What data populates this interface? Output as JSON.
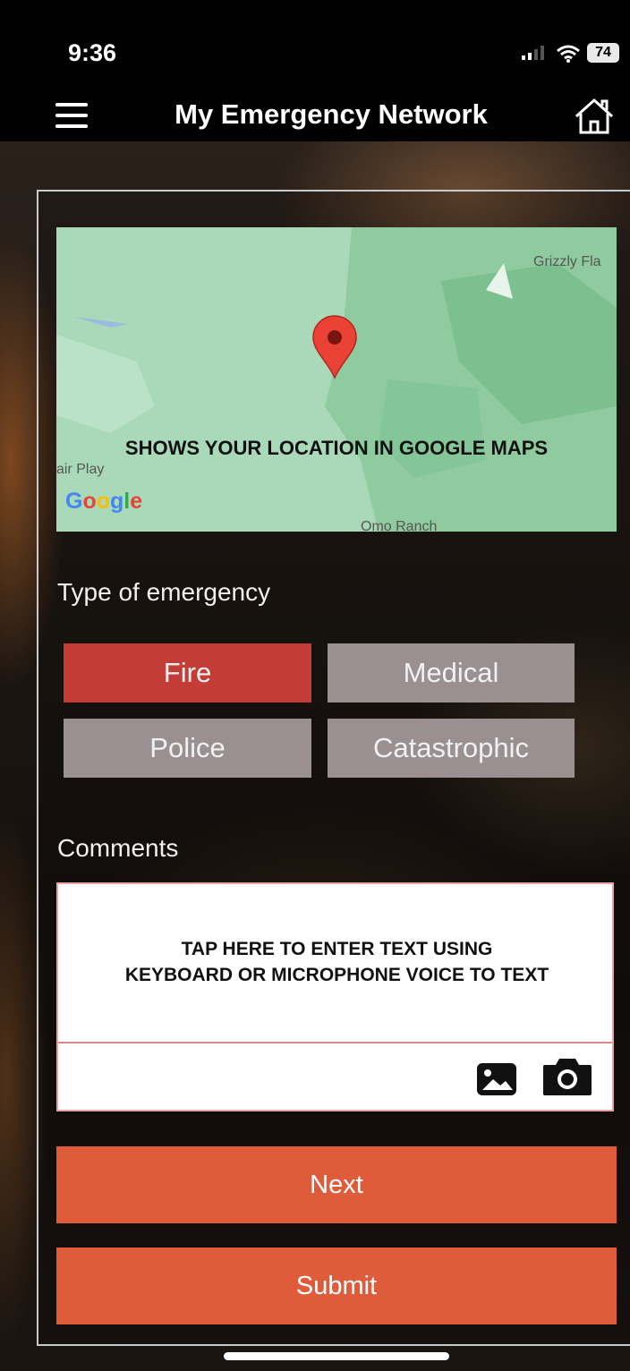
{
  "status_bar": {
    "time": "9:36",
    "battery": "74"
  },
  "header": {
    "title": "My Emergency Network"
  },
  "map": {
    "caption": "SHOWS YOUR LOCATION IN GOOGLE MAPS",
    "places": [
      "Grizzly Fla",
      "air Play",
      "Omo Ranch"
    ],
    "logo": "Google"
  },
  "emergency": {
    "label": "Type of emergency",
    "options": [
      {
        "label": "Fire",
        "selected": true
      },
      {
        "label": "Medical",
        "selected": false
      },
      {
        "label": "Police",
        "selected": false
      },
      {
        "label": "Catastrophic",
        "selected": false
      }
    ]
  },
  "comments": {
    "label": "Comments",
    "hint_line1": "TAP HERE TO ENTER TEXT USING",
    "hint_line2": "KEYBOARD OR MICROPHONE VOICE TO TEXT"
  },
  "actions": {
    "next_label": "Next",
    "submit_label": "Submit"
  },
  "colors": {
    "selected": "#c33c36",
    "unselected": "#9a9091",
    "action": "#df5c3b"
  },
  "icons": [
    "menu-icon",
    "home-icon",
    "map-pin-icon",
    "image-icon",
    "camera-icon"
  ]
}
